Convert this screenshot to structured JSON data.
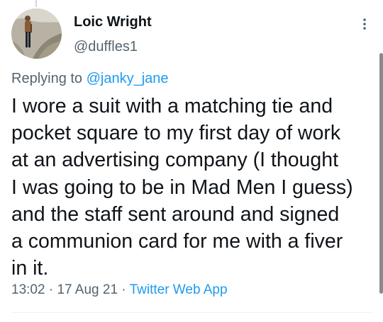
{
  "author": {
    "display_name": "Loic Wright",
    "handle": "@duffles1"
  },
  "reply": {
    "prefix": "Replying to ",
    "mention": "@janky_jane"
  },
  "tweet": {
    "lines": [
      "I wore a suit with a matching tie and",
      "pocket square to my first day of work",
      "at an advertising company (I thought",
      "I was going to be in Mad Men I guess)",
      "and the staff sent around and signed",
      "a communion card for me with a fiver",
      "in it."
    ]
  },
  "meta": {
    "time": "13:02",
    "sep1": " · ",
    "date": "17 Aug 21",
    "sep2": " · ",
    "source": "Twitter Web App"
  },
  "colors": {
    "text": "#0f1419",
    "secondary": "#536471",
    "link": "#1d9bf0"
  },
  "icons": {
    "more": "more-vertical-icon"
  }
}
